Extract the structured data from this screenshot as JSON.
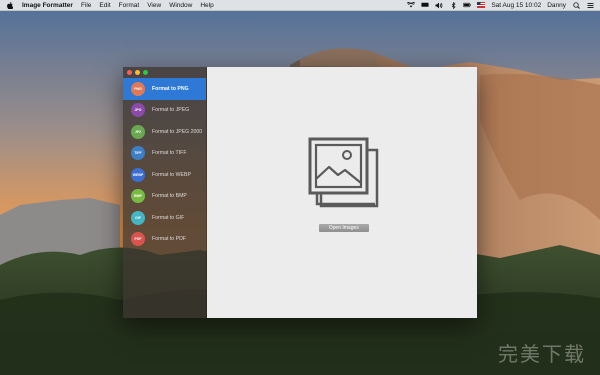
{
  "menubar": {
    "app_name": "Image Formatter",
    "items": [
      "File",
      "Edit",
      "Format",
      "View",
      "Window",
      "Help"
    ],
    "status": {
      "datetime": "Sat Aug 15  10:02",
      "user": "Danny"
    }
  },
  "sidebar": {
    "items": [
      {
        "label": "Format to PNG",
        "icon_text": "PNG",
        "color": "#e07a56",
        "selected": true
      },
      {
        "label": "Format to JPEG",
        "icon_text": "JPG",
        "color": "#8b4aa8",
        "selected": false
      },
      {
        "label": "Format to JPEG 2000",
        "icon_text": "JP2",
        "color": "#6aa84f",
        "selected": false
      },
      {
        "label": "Format to TIFF",
        "icon_text": "TIFF",
        "color": "#3d7fc4",
        "selected": false
      },
      {
        "label": "Format to WEBP",
        "icon_text": "WEBP",
        "color": "#3b6fd1",
        "selected": false
      },
      {
        "label": "Format to BMP",
        "icon_text": "BMP",
        "color": "#77bb44",
        "selected": false
      },
      {
        "label": "Format to GIF",
        "icon_text": "GIF",
        "color": "#45b5c4",
        "selected": false
      },
      {
        "label": "Format to PDF",
        "icon_text": "PDF",
        "color": "#d9534f",
        "selected": false
      }
    ]
  },
  "main": {
    "open_button_label": "Open Images"
  },
  "watermark": "完美下载"
}
